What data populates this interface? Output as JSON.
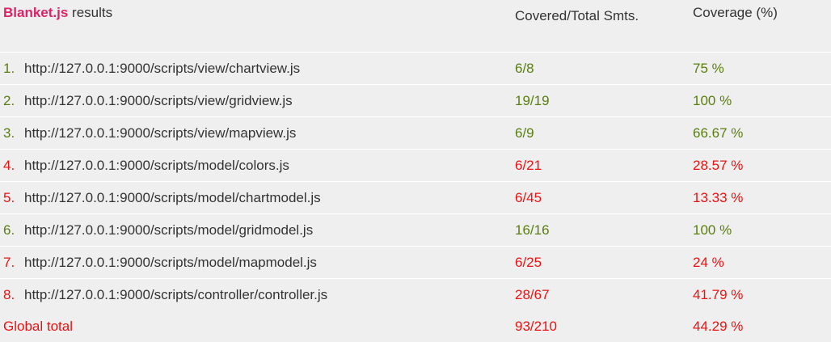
{
  "header": {
    "brand": "Blanket.js",
    "title_suffix": " results",
    "covered_total_label": "Covered/Total Smts.",
    "coverage_label": "Coverage (%)"
  },
  "rows": [
    {
      "index": "1.",
      "file": "http://127.0.0.1:9000/scripts/view/chartview.js",
      "covered": "6/8",
      "coverage": "75 %",
      "status": "ok"
    },
    {
      "index": "2.",
      "file": "http://127.0.0.1:9000/scripts/view/gridview.js",
      "covered": "19/19",
      "coverage": "100 %",
      "status": "ok"
    },
    {
      "index": "3.",
      "file": "http://127.0.0.1:9000/scripts/view/mapview.js",
      "covered": "6/9",
      "coverage": "66.67 %",
      "status": "ok"
    },
    {
      "index": "4.",
      "file": "http://127.0.0.1:9000/scripts/model/colors.js",
      "covered": "6/21",
      "coverage": "28.57 %",
      "status": "bad"
    },
    {
      "index": "5.",
      "file": "http://127.0.0.1:9000/scripts/model/chartmodel.js",
      "covered": "6/45",
      "coverage": "13.33 %",
      "status": "bad"
    },
    {
      "index": "6.",
      "file": "http://127.0.0.1:9000/scripts/model/gridmodel.js",
      "covered": "16/16",
      "coverage": "100 %",
      "status": "ok"
    },
    {
      "index": "7.",
      "file": "http://127.0.0.1:9000/scripts/model/mapmodel.js",
      "covered": "6/25",
      "coverage": "24 %",
      "status": "bad"
    },
    {
      "index": "8.",
      "file": "http://127.0.0.1:9000/scripts/controller/controller.js",
      "covered": "28/67",
      "coverage": "41.79 %",
      "status": "bad"
    }
  ],
  "total": {
    "label": "Global total",
    "covered": "93/210",
    "coverage": "44.29 %"
  },
  "colors": {
    "background": "#efefef",
    "brand": "#dd2266",
    "ok": "#5a7d10",
    "bad": "#ee1111",
    "text": "#333333"
  }
}
